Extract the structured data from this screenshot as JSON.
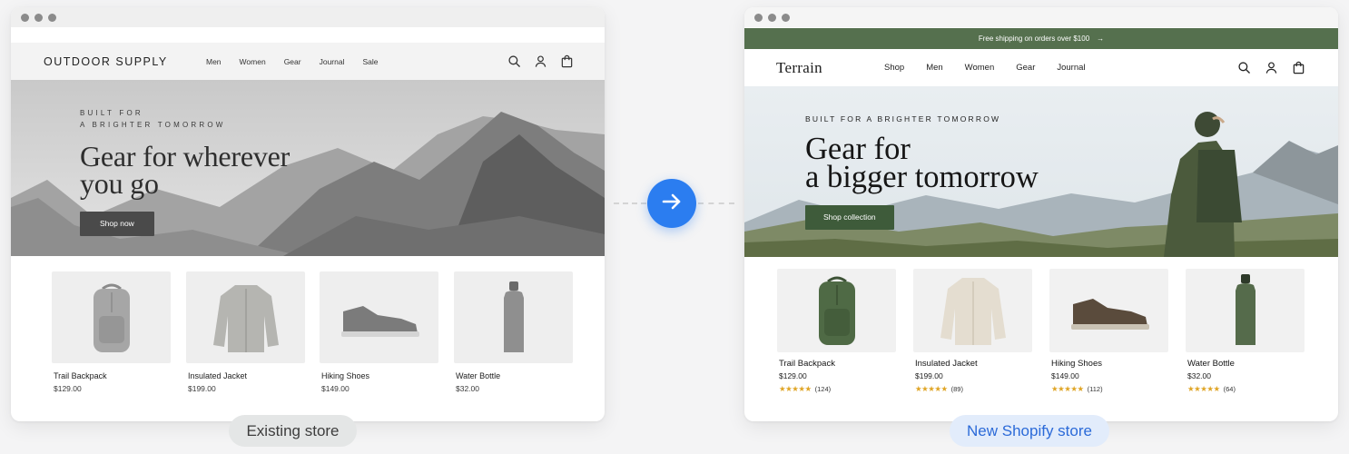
{
  "existing": {
    "logo": "OUTDOOR SUPPLY",
    "nav": [
      "Men",
      "Women",
      "Gear",
      "Journal",
      "Sale"
    ],
    "eyebrow_line1": "BUILT FOR",
    "eyebrow_line2": "A BRIGHTER TOMORROW",
    "headline_line1": "Gear for wherever",
    "headline_line2": "you go",
    "cta": "Shop now",
    "products": [
      {
        "name": "Trail Backpack",
        "price": "$129.00"
      },
      {
        "name": "Insulated Jacket",
        "price": "$199.00"
      },
      {
        "name": "Hiking Shoes",
        "price": "$149.00"
      },
      {
        "name": "Water Bottle",
        "price": "$32.00"
      }
    ],
    "label": "Existing store"
  },
  "new": {
    "announcement": "Free shipping on orders over $100",
    "announcement_arrow": "→",
    "logo": "Terrain",
    "nav": [
      "Shop",
      "Men",
      "Women",
      "Gear",
      "Journal"
    ],
    "eyebrow": "BUILT FOR A BRIGHTER TOMORROW",
    "headline_line1": "Gear for",
    "headline_line2": "a bigger tomorrow",
    "cta": "Shop collection",
    "products": [
      {
        "name": "Trail Backpack",
        "price": "$129.00",
        "stars": "★★★★★",
        "reviews": "(124)"
      },
      {
        "name": "Insulated Jacket",
        "price": "$199.00",
        "stars": "★★★★★",
        "reviews": "(89)"
      },
      {
        "name": "Hiking Shoes",
        "price": "$149.00",
        "stars": "★★★★★",
        "reviews": "(112)"
      },
      {
        "name": "Water Bottle",
        "price": "$32.00",
        "stars": "★★★★★",
        "reviews": "(64)"
      }
    ],
    "label": "New Shopify store"
  },
  "icons": {
    "nav": [
      "search-icon",
      "account-icon",
      "bag-icon"
    ],
    "transition": "arrow-right-icon"
  },
  "colors": {
    "brand_green": "#55704e",
    "cta_green": "#3e5b3a",
    "accent_blue": "#2b7df0",
    "star": "#e0a526"
  }
}
